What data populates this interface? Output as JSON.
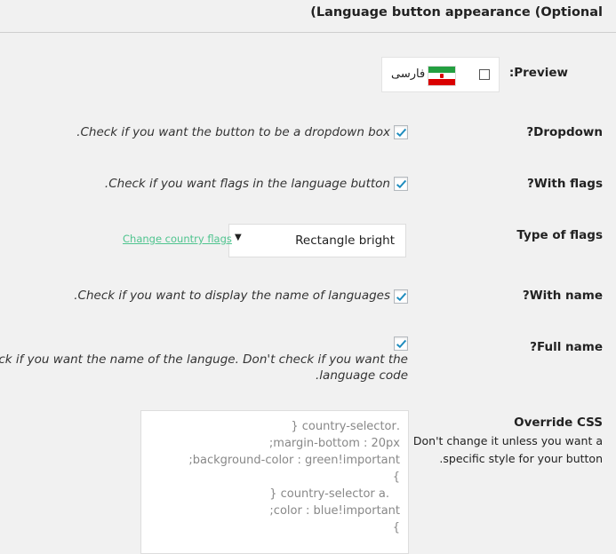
{
  "section": {
    "title": "(Language button appearance (Optional"
  },
  "preview": {
    "label": "Preview:",
    "language_name": "فارسی",
    "flag_icon": "iran-flag"
  },
  "rows": {
    "dropdown": {
      "label": "Dropdown?",
      "desc": "Check if you want the button to be a dropdown box.",
      "checked": true
    },
    "with_flags": {
      "label": "With flags?",
      "desc": "Check if you want flags in the language button.",
      "checked": true
    },
    "type_of_flags": {
      "label": "Type of flags",
      "selected": "Rectangle bright",
      "link": "Change country flags"
    },
    "with_name": {
      "label": "With name?",
      "desc": "Check if you want to display the name of languages.",
      "checked": true
    },
    "full_name": {
      "label": "Full name?",
      "desc_line1": "Check if you want the name of the languge. Don't check if you want the",
      "desc_line2": "language code.",
      "checked": true
    },
    "override_css": {
      "label": "Override CSS",
      "help_line1": "Don't change it unless you want a",
      "help_line2": "specific style for your button.",
      "lines": [
        ".country-selector {",
        "margin-bottom : 20px;",
        "background-color : green!important;",
        "}",
        ".country-selector a {",
        "color : blue!important;",
        "}"
      ]
    }
  },
  "colors": {
    "accent": "#4fc48f",
    "check": "#1e8cbe"
  }
}
